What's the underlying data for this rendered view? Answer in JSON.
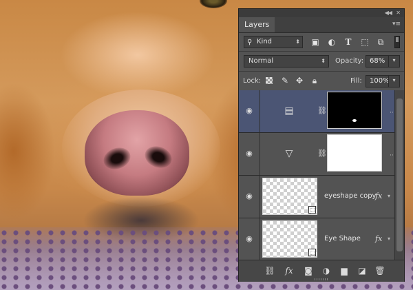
{
  "panel": {
    "tab_label": "Layers",
    "filter": {
      "kind_label": "Kind"
    },
    "blend_mode": "Normal",
    "opacity_label": "Opacity:",
    "opacity_value": "68%",
    "lock_label": "Lock:",
    "fill_label": "Fill:",
    "fill_value": "100%"
  },
  "layers": [
    {
      "name": "",
      "type": "adjustment-solid-color",
      "mask": "black",
      "selected": true
    },
    {
      "name": "",
      "type": "adjustment-gradient",
      "mask": "white",
      "selected": false
    },
    {
      "name": "eyeshape copy",
      "type": "shape",
      "has_fx": true,
      "selected": false
    },
    {
      "name": "Eye Shape",
      "type": "shape",
      "has_fx": true,
      "selected": false
    }
  ],
  "icons": {
    "fx_symbol": "fx"
  }
}
